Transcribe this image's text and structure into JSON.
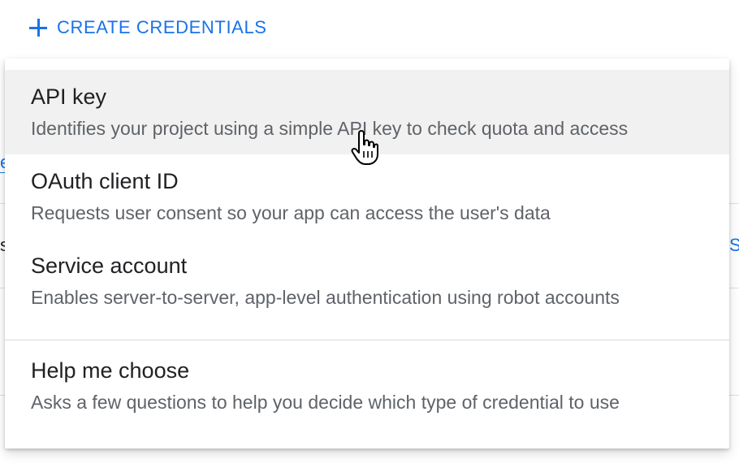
{
  "toolbar": {
    "create_label": "CREATE CREDENTIALS",
    "plus_icon": "plus-icon"
  },
  "background": {
    "left_link_fragment": "e",
    "left_text_fragment": "s",
    "right_link_fragment": "S"
  },
  "menu": {
    "items": [
      {
        "title": "API key",
        "description": "Identifies your project using a simple API key to check quota and access"
      },
      {
        "title": "OAuth client ID",
        "description": "Requests user consent so your app can access the user's data"
      },
      {
        "title": "Service account",
        "description": "Enables server-to-server, app-level authentication using robot accounts"
      },
      {
        "title": "Help me choose",
        "description": "Asks a few questions to help you decide which type of credential to use"
      }
    ]
  },
  "colors": {
    "accent": "#1a73e8",
    "title_text": "#202124",
    "desc_text": "#5f6368",
    "hover_bg": "#f1f1f1",
    "divider": "#dadce0"
  },
  "cursor": "hand-pointer-cursor"
}
